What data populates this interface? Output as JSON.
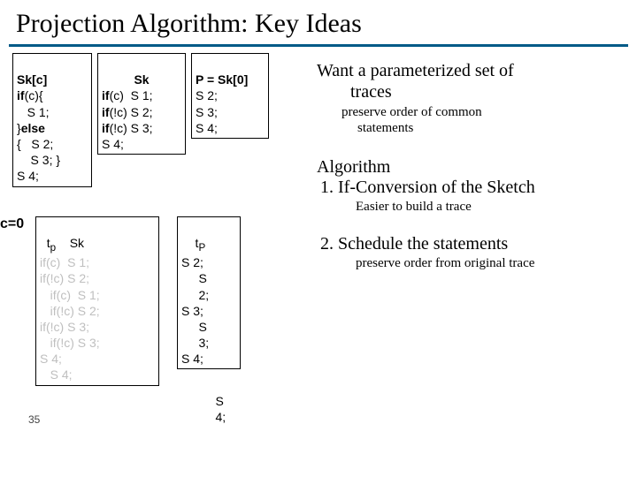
{
  "title": "Projection Algorithm: Key Ideas",
  "top_row": {
    "col1_header": "Sk[c]",
    "col2_header": "Sk",
    "col3_header": "P = Sk[0]",
    "col1_code": "if(c){\n   S 1;\n}else\n{   S 2;\n    S 3; }\nS 4;",
    "col2_code": "if(c)  S 1;\nif(!c) S 2;\nif(!c) S 3;\nS 4;",
    "col3_code": "S 2;\nS 3;\nS 4;"
  },
  "c0_label": "c=0",
  "arrow": "▸",
  "tp_header": "tp     Sk",
  "tp_ghost": "if(c)  S 1;\nif(!c) S 2;\n   if(c)  S 1;\n   if(!c) S 2;\nif(!c) S 3;\n   if(!c) S 3;\nS 4;\n   S 4;",
  "tp2_header": "tP",
  "tp2_code": "S 2;\n     S\n     2;\nS 3;\n     S\n     3;\nS 4;",
  "overflow_code": "     S\n     4;",
  "slide_num": "35",
  "right": {
    "want": "Want a parameterized set of",
    "want2": "traces",
    "preserve": "preserve order of common",
    "preserve2": "statements",
    "algo": "Algorithm",
    "item1": "1.   If-Conversion of the Sketch",
    "item1_sub": "Easier to build a trace",
    "item2": "2.   Schedule the statements",
    "item2_sub": "preserve order from original trace"
  }
}
